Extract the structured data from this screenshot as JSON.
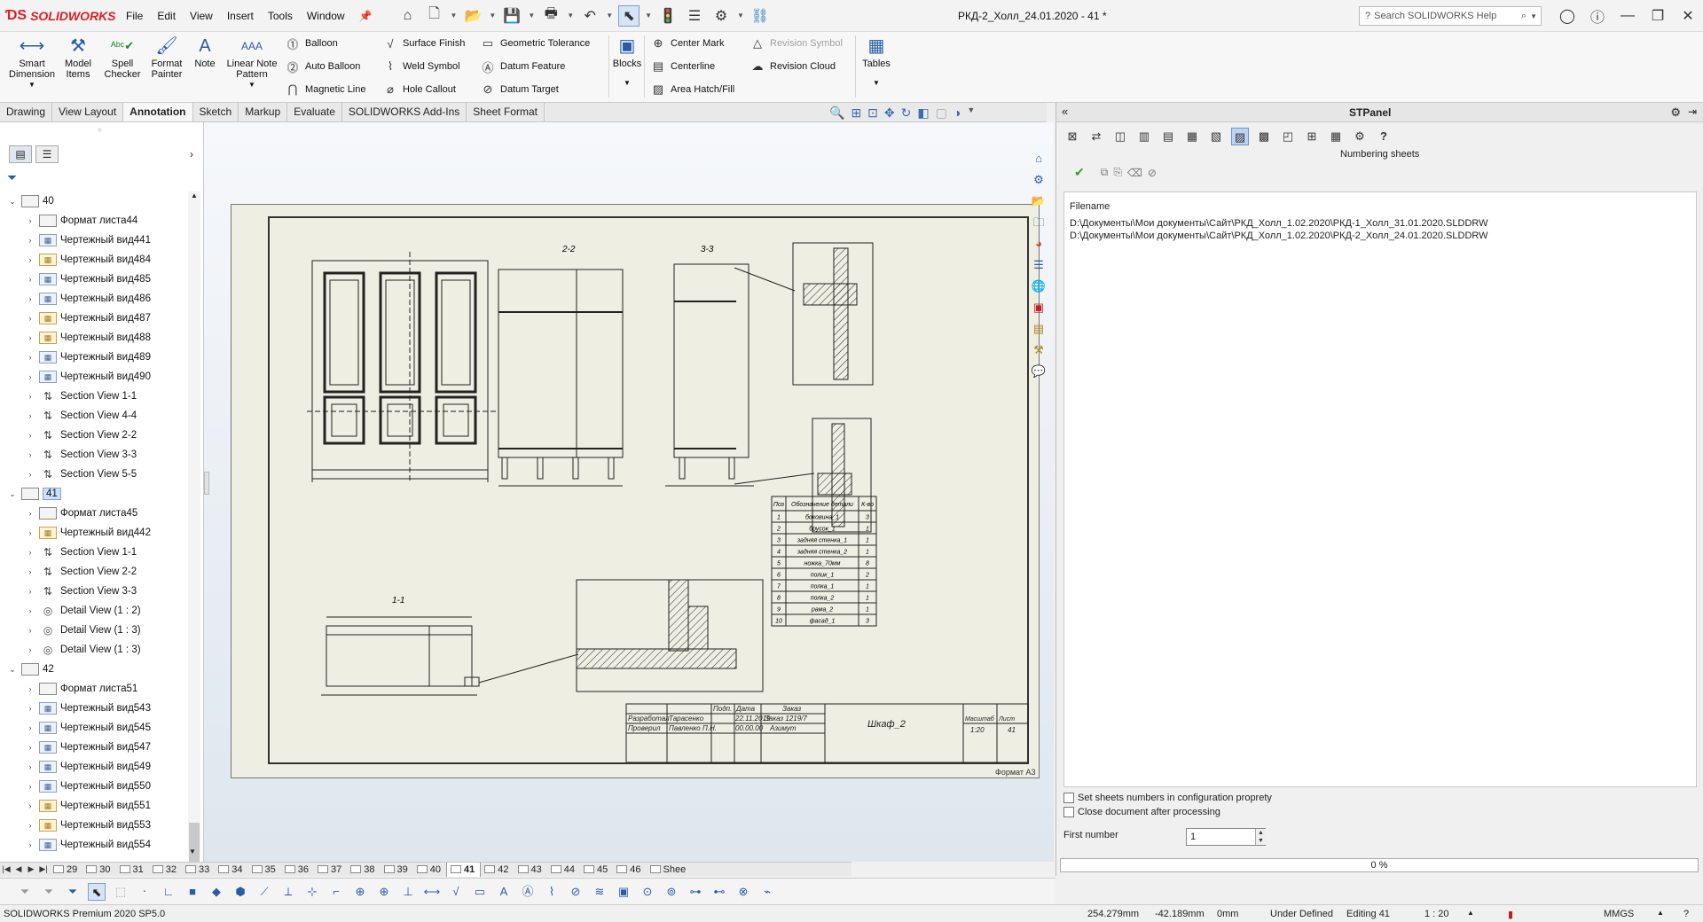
{
  "app": {
    "logo_text": "SOLIDWORKS",
    "document_title": "РКД-2_Холл_24.01.2020 - 41 *",
    "search_placeholder": "Search SOLIDWORKS Help"
  },
  "menu": [
    "File",
    "Edit",
    "View",
    "Insert",
    "Tools",
    "Window"
  ],
  "ribbon": {
    "big_buttons": [
      {
        "label": "Smart\nDimension",
        "icon": "smart-dimension-icon"
      },
      {
        "label": "Model\nItems",
        "icon": "model-items-icon"
      },
      {
        "label": "Spell\nChecker",
        "icon": "spell-checker-icon"
      },
      {
        "label": "Format\nPainter",
        "icon": "format-painter-icon"
      },
      {
        "label": "Note",
        "icon": "note-icon"
      },
      {
        "label": "Linear Note\nPattern",
        "icon": "linear-note-pattern-icon"
      }
    ],
    "col1": [
      "Balloon",
      "Auto Balloon",
      "Magnetic Line"
    ],
    "col2": [
      "Surface Finish",
      "Weld Symbol",
      "Hole Callout"
    ],
    "col3": [
      "Geometric Tolerance",
      "Datum Feature",
      "Datum Target"
    ],
    "blocks": "Blocks",
    "col4": [
      "Center Mark",
      "Centerline",
      "Area Hatch/Fill"
    ],
    "col5": [
      "Revision Symbol",
      "Revision Cloud"
    ],
    "tables": "Tables"
  },
  "tabs": [
    {
      "label": "Drawing",
      "active": false
    },
    {
      "label": "View Layout",
      "active": false
    },
    {
      "label": "Annotation",
      "active": true
    },
    {
      "label": "Sketch",
      "active": false
    },
    {
      "label": "Markup",
      "active": false
    },
    {
      "label": "Evaluate",
      "active": false
    },
    {
      "label": "SOLIDWORKS Add-Ins",
      "active": false
    },
    {
      "label": "Sheet Format",
      "active": false
    }
  ],
  "tree": [
    {
      "label": "40",
      "type": "sheet",
      "level": 0,
      "expanded": true
    },
    {
      "label": "Формат листа44",
      "type": "format",
      "level": 1
    },
    {
      "label": "Чертежный вид441",
      "type": "view",
      "level": 1
    },
    {
      "label": "Чертежный вид484",
      "type": "view2",
      "level": 1
    },
    {
      "label": "Чертежный вид485",
      "type": "view",
      "level": 1
    },
    {
      "label": "Чертежный вид486",
      "type": "view",
      "level": 1
    },
    {
      "label": "Чертежный вид487",
      "type": "view2",
      "level": 1
    },
    {
      "label": "Чертежный вид488",
      "type": "view2",
      "level": 1
    },
    {
      "label": "Чертежный вид489",
      "type": "view",
      "level": 1
    },
    {
      "label": "Чертежный вид490",
      "type": "view",
      "level": 1
    },
    {
      "label": "Section View 1-1",
      "type": "section",
      "level": 1
    },
    {
      "label": "Section View 4-4",
      "type": "section",
      "level": 1
    },
    {
      "label": "Section View 2-2",
      "type": "section",
      "level": 1
    },
    {
      "label": "Section View 3-3",
      "type": "section",
      "level": 1
    },
    {
      "label": "Section View 5-5",
      "type": "section",
      "level": 1
    },
    {
      "label": "41",
      "type": "sheet",
      "level": 0,
      "expanded": true,
      "selected": true
    },
    {
      "label": "Формат листа45",
      "type": "format",
      "level": 1
    },
    {
      "label": "Чертежный вид442",
      "type": "view2",
      "level": 1
    },
    {
      "label": "Section View 1-1",
      "type": "section",
      "level": 1
    },
    {
      "label": "Section View 2-2",
      "type": "section",
      "level": 1
    },
    {
      "label": "Section View 3-3",
      "type": "section",
      "level": 1
    },
    {
      "label": "Detail View  (1 : 2)",
      "type": "detail",
      "level": 1
    },
    {
      "label": "Detail View  (1 : 3)",
      "type": "detail",
      "level": 1
    },
    {
      "label": "Detail View  (1 : 3)",
      "type": "detail",
      "level": 1
    },
    {
      "label": "42",
      "type": "sheet",
      "level": 0,
      "expanded": true
    },
    {
      "label": "Формат листа51",
      "type": "format",
      "level": 1
    },
    {
      "label": "Чертежный вид543",
      "type": "view",
      "level": 1
    },
    {
      "label": "Чертежный вид545",
      "type": "view",
      "level": 1
    },
    {
      "label": "Чертежный вид547",
      "type": "view",
      "level": 1
    },
    {
      "label": "Чертежный вид549",
      "type": "view",
      "level": 1
    },
    {
      "label": "Чертежный вид550",
      "type": "view",
      "level": 1
    },
    {
      "label": "Чертежный вид551",
      "type": "view2",
      "level": 1
    },
    {
      "label": "Чертежный вид553",
      "type": "view2",
      "level": 1
    },
    {
      "label": "Чертежный вид554",
      "type": "view",
      "level": 1
    }
  ],
  "drawing": {
    "labels": {
      "sec22": "2-2",
      "sec33": "3-3",
      "sec11": "1-1",
      "sheet_format": "Формат А3"
    },
    "bom_headers": [
      "Поз",
      "Обозначение детали",
      "К-во"
    ],
    "bom_rows": [
      [
        "1",
        "боковина_1",
        "3"
      ],
      [
        "2",
        "брусок_1",
        "1"
      ],
      [
        "3",
        "задняя стенка_1",
        "1"
      ],
      [
        "4",
        "задняя стенка_2",
        "1"
      ],
      [
        "5",
        "ножка_70мм",
        "8"
      ],
      [
        "6",
        "полик_1",
        "2"
      ],
      [
        "7",
        "полка_1",
        "1"
      ],
      [
        "8",
        "полка_2",
        "1"
      ],
      [
        "9",
        "рама_2",
        "1"
      ],
      [
        "10",
        "фасад_1",
        "3"
      ]
    ],
    "title_block": {
      "developed": "Разработал",
      "developer": "Тарасенко",
      "checked": "Проверил",
      "checker": "Павленко П.Н.",
      "sign": "Подп.",
      "date": "Дата",
      "date1": "22.11.2019",
      "date2": "00.00.00",
      "order_h": "Заказ",
      "order": "Заказ 1219/7",
      "company": "Азимут",
      "name": "Шкаф_2",
      "scale_h": "Масштаб",
      "scale": "1:20",
      "sheet_h": "Лист",
      "sheet": "41"
    }
  },
  "sheet_tabs": [
    "29",
    "30",
    "31",
    "32",
    "33",
    "34",
    "35",
    "36",
    "37",
    "38",
    "39",
    "40",
    "41",
    "42",
    "43",
    "44",
    "45",
    "46",
    "Shee"
  ],
  "active_sheet": "41",
  "stpanel": {
    "title": "STPanel",
    "tooltip": "Numbering sheets",
    "filename_header": "Filename",
    "files": [
      "D:\\Документы\\Мои документы\\Сайт\\РКД_Холл_1.02.2020\\РКД-1_Холл_31.01.2020.SLDDRW",
      "D:\\Документы\\Мои документы\\Сайт\\РКД_Холл_1.02.2020\\РКД-2_Холл_24.01.2020.SLDDRW"
    ],
    "opt_config": "Set sheets numbers in configuration proprety",
    "opt_close": "Close document after processing",
    "first_number_label": "First number",
    "first_number": "1",
    "progress": "0 %"
  },
  "status": {
    "product": "SOLIDWORKS Premium 2020 SP5.0",
    "x": "254.279mm",
    "y": "-42.189mm",
    "z": "0mm",
    "state": "Under Defined",
    "editing": "Editing 41",
    "scale": "1 : 20",
    "units": "MMGS"
  }
}
